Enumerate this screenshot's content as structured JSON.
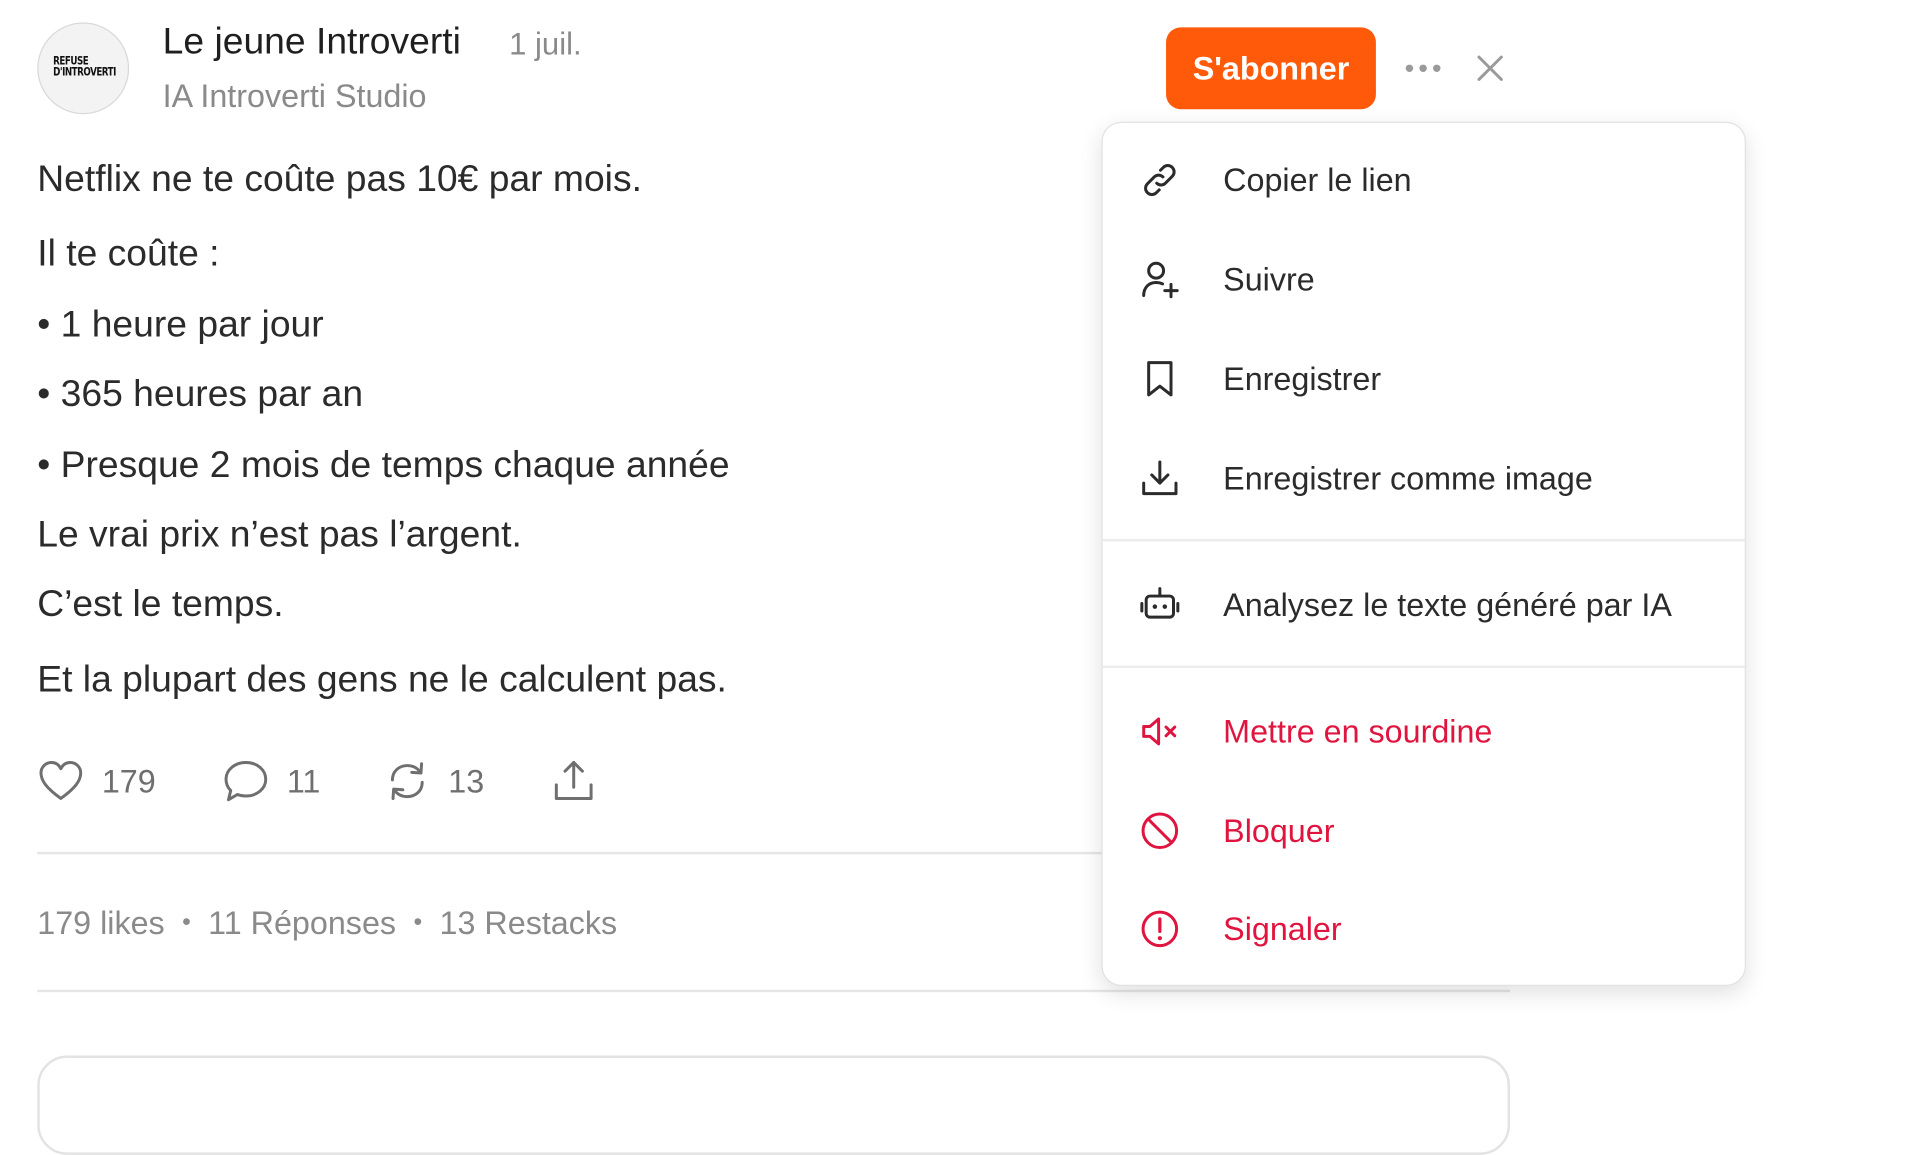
{
  "post": {
    "avatar_text": "REFUSE D'INTROVERTI",
    "author_name": "Le jeune Introverti",
    "date": "1 juil.",
    "publication": "IA Introverti Studio",
    "subscribe_label": "S'abonner",
    "lines": [
      "Netflix ne te coûte pas 10€ par mois.",
      "Il te coûte :",
      "• 1 heure par jour",
      "• 365 heures par an",
      "• Presque 2 mois de temps chaque année",
      "Le vrai prix n’est pas l’argent.",
      "C’est le temps.",
      "Et la plupart des gens ne le calculent pas."
    ]
  },
  "actions": {
    "likes": "179",
    "comments": "11",
    "restacks": "13"
  },
  "stats": {
    "likes": "179 likes",
    "replies": "11 Réponses",
    "restacks": "13 Restacks"
  },
  "menu": {
    "items": [
      {
        "label": "Copier le lien",
        "icon": "link-icon"
      },
      {
        "label": "Suivre",
        "icon": "follow-user-icon"
      },
      {
        "label": "Enregistrer",
        "icon": "bookmark-icon"
      },
      {
        "label": "Enregistrer comme image",
        "icon": "download-icon"
      },
      {
        "label": "Analysez le texte généré par IA",
        "icon": "robot-icon"
      },
      {
        "label": "Mettre en sourdine",
        "icon": "mute-icon"
      },
      {
        "label": "Bloquer",
        "icon": "block-icon"
      },
      {
        "label": "Signaler",
        "icon": "report-icon"
      }
    ]
  },
  "colors": {
    "accent": "#ff5a0a",
    "danger": "#e0153f",
    "text": "#2b2b2b",
    "muted": "#8a8a8a"
  }
}
